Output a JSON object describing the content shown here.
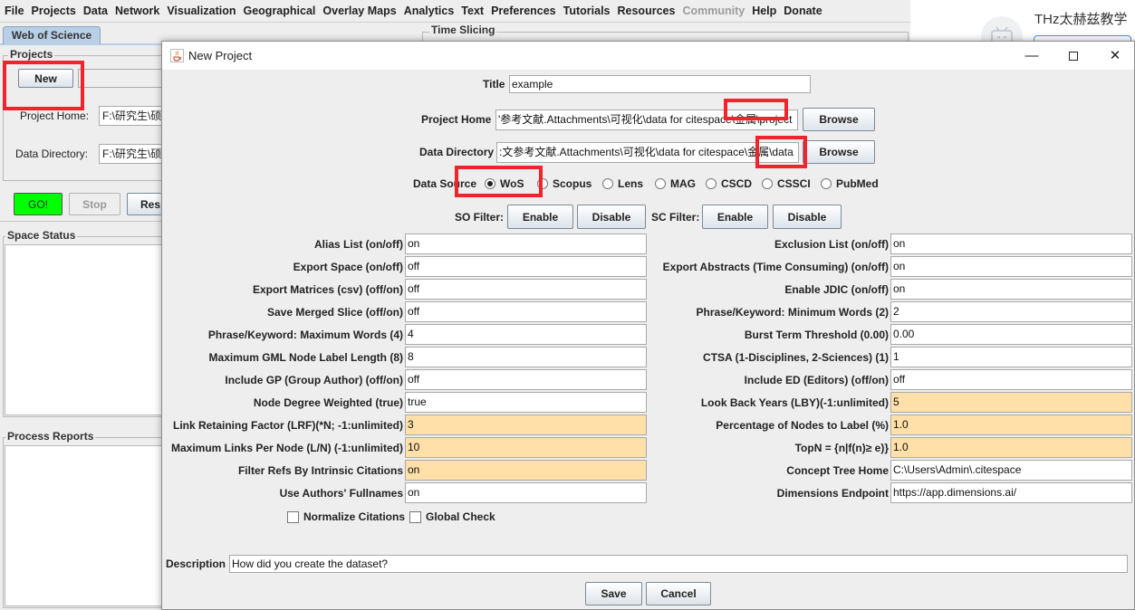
{
  "menubar": {
    "items": [
      "File",
      "Projects",
      "Data",
      "Network",
      "Visualization",
      "Geographical",
      "Overlay Maps",
      "Analytics",
      "Text",
      "Preferences",
      "Tutorials",
      "Resources",
      "Community",
      "Help",
      "Donate"
    ]
  },
  "background": {
    "tab": "Web of Science",
    "projects_title": "Projects",
    "new_button": "New",
    "project_home_label": "Project Home:",
    "project_home_value": "F:\\研究生\\硕士",
    "data_directory_label": "Data Directory:",
    "data_directory_value": "F:\\研究生\\硕士",
    "go_button": "GO!",
    "stop_button": "Stop",
    "reset_button": "Res",
    "time_slicing_title": "Time Slicing",
    "space_status_title": "Space Status",
    "process_reports_title": "Process Reports",
    "corner_user": "THz太赫兹教学"
  },
  "dialog": {
    "title": "New Project",
    "title_label": "Title",
    "title_value": "example",
    "project_home_label": "Project Home",
    "project_home_value": "'参考文献.Attachments\\可视化\\data for citespace\\金属\\project",
    "data_directory_label": "Data Directory",
    "data_directory_value": ":文参考文献.Attachments\\可视化\\data for citespace\\金属\\data",
    "browse": "Browse",
    "data_source_label": "Data Source",
    "data_sources": [
      "WoS",
      "Scopus",
      "Lens",
      "MAG",
      "CSCD",
      "CSSCI",
      "PubMed"
    ],
    "data_source_selected": "WoS",
    "so_filter_label": "SO Filter:",
    "sc_filter_label": "SC Filter:",
    "enable": "Enable",
    "disable": "Disable",
    "left_params": [
      {
        "label": "Alias List (on/off)",
        "value": "on"
      },
      {
        "label": "Export Space (on/off)",
        "value": "off"
      },
      {
        "label": "Export Matrices (csv) (off/on)",
        "value": "off"
      },
      {
        "label": "Save Merged Slice (off/on)",
        "value": "off"
      },
      {
        "label": "Phrase/Keyword: Maximum Words (4)",
        "value": "4"
      },
      {
        "label": "Maximum GML Node Label Length (8)",
        "value": "8"
      },
      {
        "label": "Include GP (Group Author) (off/on)",
        "value": "off"
      },
      {
        "label": "Node Degree Weighted (true)",
        "value": "true"
      },
      {
        "label": "Link Retaining Factor (LRF)(*N; -1:unlimited)",
        "value": "3"
      },
      {
        "label": "Maximum Links Per Node (L/N) (-1:unlimited)",
        "value": "10"
      },
      {
        "label": "Filter Refs By Intrinsic Citations",
        "value": "on"
      },
      {
        "label": "Use Authors' Fullnames",
        "value": "on"
      }
    ],
    "right_params": [
      {
        "label": "Exclusion List (on/off)",
        "value": "on"
      },
      {
        "label": "Export Abstracts (Time Consuming) (on/off)",
        "value": "on"
      },
      {
        "label": "Enable JDIC (on/off)",
        "value": "on"
      },
      {
        "label": "Phrase/Keyword: Minimum Words (2)",
        "value": "2"
      },
      {
        "label": "Burst Term Threshold (0.00)",
        "value": "0.00"
      },
      {
        "label": "CTSA (1-Disciplines, 2-Sciences) (1)",
        "value": "1"
      },
      {
        "label": "Include ED (Editors) (off/on)",
        "value": "off"
      },
      {
        "label": "Look Back Years (LBY)(-1:unlimited)",
        "value": "5"
      },
      {
        "label": "Percentage of Nodes to Label (%)",
        "value": "1.0"
      },
      {
        "label": "TopN = {n|f(n)≥ e)}",
        "value": "1.0"
      },
      {
        "label": "Concept Tree Home",
        "value": "C:\\Users\\Admin\\.citespace"
      },
      {
        "label": "Dimensions Endpoint",
        "value": "https://app.dimensions.ai/"
      }
    ],
    "normalize_citations": "Normalize Citations",
    "global_check": "Global Check",
    "description_label": "Description",
    "description_value": "How did you create the dataset?",
    "save": "Save",
    "cancel": "Cancel",
    "highlight_color": "#ffe0a8",
    "annotation_color": "#f0242d"
  }
}
